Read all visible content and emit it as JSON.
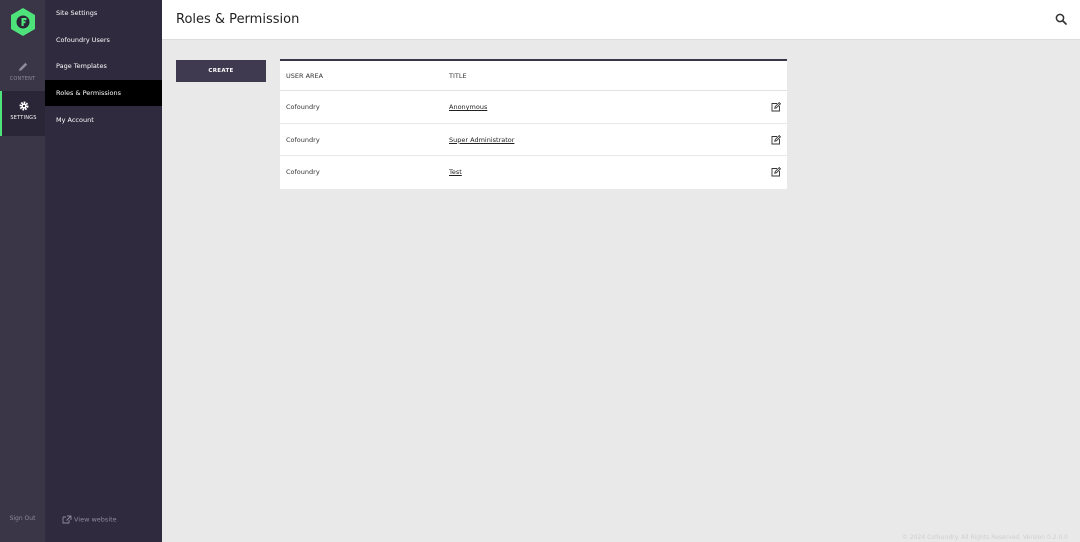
{
  "rail": {
    "items": [
      {
        "label": "CONTENT",
        "icon": "pencil-icon"
      },
      {
        "label": "SETTINGS",
        "icon": "gear-icon"
      }
    ],
    "sign_out": "Sign Out"
  },
  "menu": {
    "items": [
      {
        "label": "Site Settings"
      },
      {
        "label": "Cofoundry Users"
      },
      {
        "label": "Page Templates"
      },
      {
        "label": "Roles & Permissions"
      },
      {
        "label": "My Account"
      }
    ],
    "view_website": "View website"
  },
  "header": {
    "title": "Roles & Permission"
  },
  "toolbar": {
    "create_label": "CREATE"
  },
  "table": {
    "columns": [
      "USER AREA",
      "TITLE"
    ],
    "rows": [
      {
        "user_area": "Cofoundry",
        "title": "Anonymous"
      },
      {
        "user_area": "Cofoundry",
        "title": "Super Administrator"
      },
      {
        "user_area": "Cofoundry",
        "title": "Test"
      }
    ]
  },
  "footer": {
    "text": "© 2024 Cofoundry. All Rights Reserved. Version 0.2.0.0"
  },
  "colors": {
    "accent": "#4ee27a",
    "rail_bg": "#3a3547",
    "menu_bg": "#2f2a3d",
    "active_menu_bg": "#000000",
    "button_bg": "#3f3a50"
  }
}
